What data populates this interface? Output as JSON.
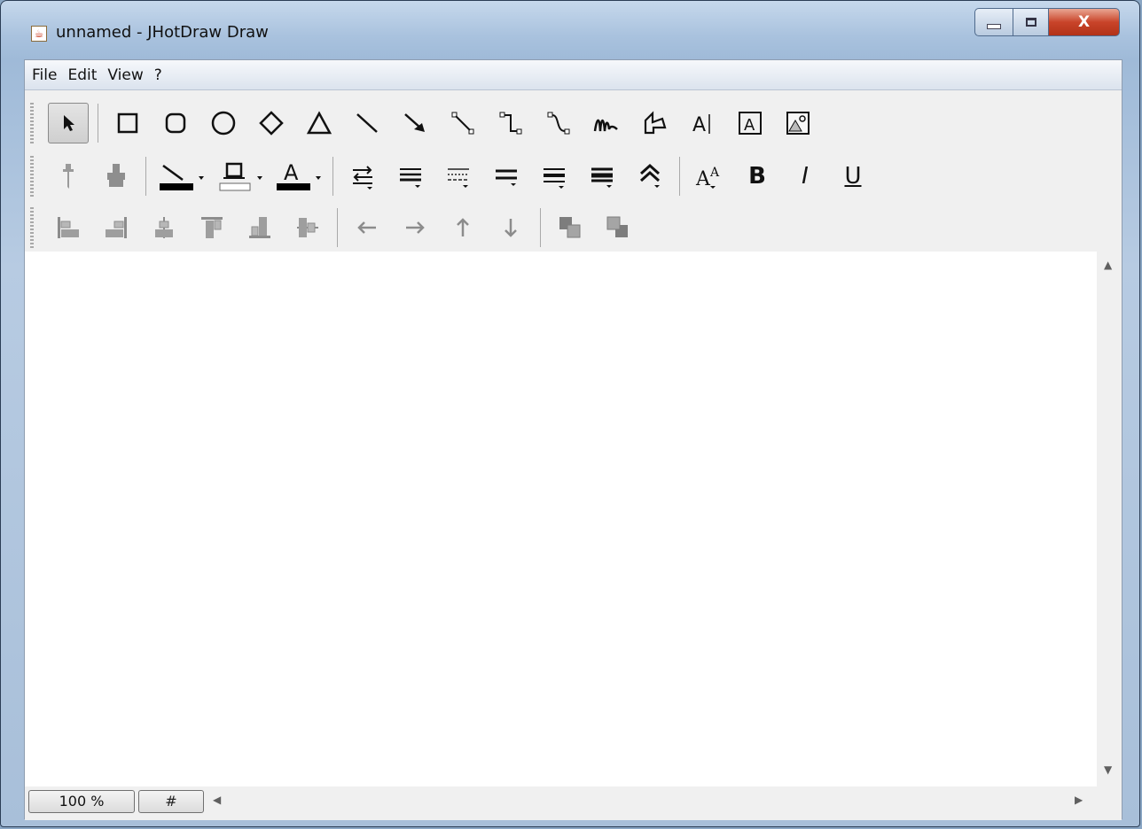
{
  "window": {
    "title": "unnamed - JHotDraw Draw",
    "controls": {
      "minimize": "—",
      "maximize": "▢",
      "close": "X"
    }
  },
  "menu": {
    "items": [
      "File",
      "Edit",
      "View",
      "?"
    ]
  },
  "toolbars": {
    "drawing_tools": [
      "selection-tool",
      "rectangle-tool",
      "round-rectangle-tool",
      "ellipse-tool",
      "diamond-tool",
      "triangle-tool",
      "line-tool",
      "arrow-tool",
      "connection-tool",
      "elbow-connection-tool",
      "curved-connection-tool",
      "scribble-tool",
      "polygon-tool",
      "text-tool",
      "text-area-tool",
      "image-tool"
    ],
    "attribute_tools": [
      "pick-attributes",
      "apply-attributes",
      "stroke-color",
      "fill-color",
      "text-color",
      "stroke-decoration",
      "stroke-width",
      "stroke-dashes",
      "stroke-type",
      "stroke-placement",
      "stroke-join",
      "stroke-miter",
      "font-size",
      "bold",
      "italic",
      "underline"
    ],
    "font_labels": {
      "bold": "B",
      "italic": "I",
      "underline": "U",
      "text_color": "A"
    },
    "arrange_tools": [
      "align-left",
      "align-right",
      "align-center",
      "align-top",
      "align-bottom",
      "align-middle",
      "move-left",
      "move-right",
      "move-up",
      "move-down",
      "bring-to-front",
      "send-to-back"
    ]
  },
  "statusbar": {
    "zoom_label": "100 %",
    "grid_label": "#"
  },
  "colors": {
    "stroke": "#000000",
    "fill": "#ffffff",
    "text": "#000000"
  }
}
